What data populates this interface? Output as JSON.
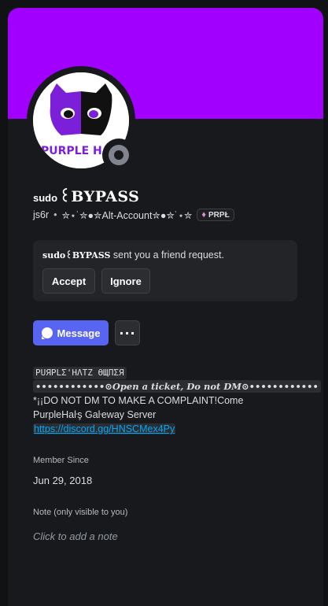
{
  "profile": {
    "banner_color": "#a100ff",
    "avatar_alt_text": "PURPLE HA",
    "status": "offline",
    "display_name_prefix": "sudo",
    "display_name_fancy": "꒰BYPASS",
    "username": "js6r",
    "separator": "•",
    "pronouns_label": "✮⋆˙✮●✮Alt-Account✮●✮˙⋆✮",
    "tag_text": "PRPŁ",
    "tag_icon": "flame-icon"
  },
  "friend_request": {
    "sender_name": "sudo꒰BYPASS",
    "message": " sent you a friend request.",
    "accept_label": "Accept",
    "ignore_label": "Ignore"
  },
  "actions": {
    "message_label": "Message",
    "more_label": "···"
  },
  "bio": {
    "line1": "PUЯPLΣ'HΛTZ ӨЩПΣЯ",
    "line2": "••••••••••••⊙Open a ticket, Do not DM⊙••••••••••••",
    "line3": "*¡¡DO NOT DM TO MAKE A COMPLAINT!Come",
    "line4": "PurpleHaŀş Gaŀeway Server",
    "link": "https://discord.gg/HNSCMex4Py"
  },
  "member_since": {
    "label": "Member Since",
    "value": "Jun 29, 2018"
  },
  "note": {
    "label": "Note (only visible to you)",
    "placeholder": "Click to add a note"
  }
}
